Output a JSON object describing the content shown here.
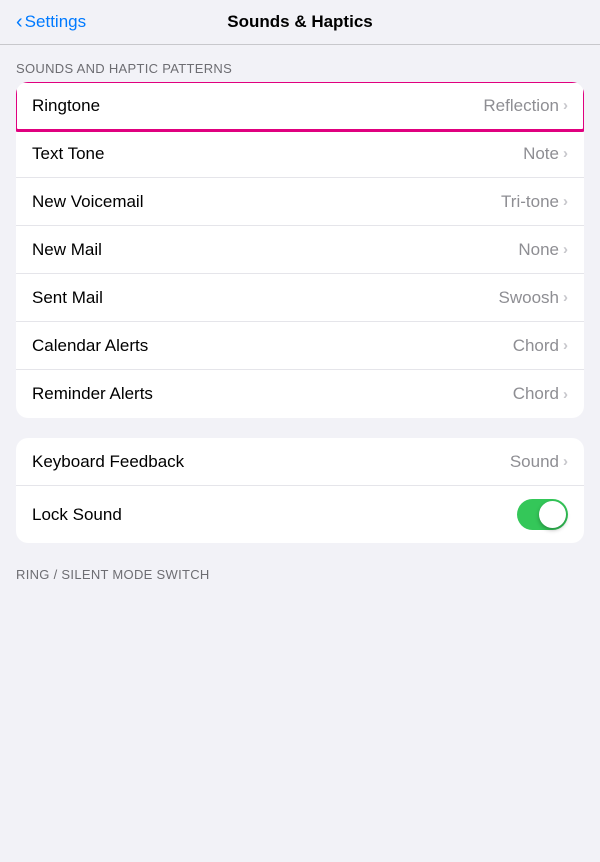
{
  "header": {
    "back_label": "Settings",
    "title": "Sounds & Haptics"
  },
  "sounds_section": {
    "label": "SOUNDS AND HAPTIC PATTERNS",
    "rows": [
      {
        "id": "ringtone",
        "label": "Ringtone",
        "value": "Reflection",
        "highlighted": true
      },
      {
        "id": "text-tone",
        "label": "Text Tone",
        "value": "Note",
        "highlighted": false
      },
      {
        "id": "new-voicemail",
        "label": "New Voicemail",
        "value": "Tri-tone",
        "highlighted": false
      },
      {
        "id": "new-mail",
        "label": "New Mail",
        "value": "None",
        "highlighted": false
      },
      {
        "id": "sent-mail",
        "label": "Sent Mail",
        "value": "Swoosh",
        "highlighted": false
      },
      {
        "id": "calendar-alerts",
        "label": "Calendar Alerts",
        "value": "Chord",
        "highlighted": false
      },
      {
        "id": "reminder-alerts",
        "label": "Reminder Alerts",
        "value": "Chord",
        "highlighted": false
      }
    ]
  },
  "feedback_section": {
    "rows": [
      {
        "id": "keyboard-feedback",
        "label": "Keyboard Feedback",
        "value": "Sound",
        "type": "navigation"
      },
      {
        "id": "lock-sound",
        "label": "Lock Sound",
        "type": "toggle",
        "enabled": true
      }
    ]
  },
  "bottom_section": {
    "label": "RING / SILENT MODE SWITCH"
  },
  "icons": {
    "chevron": "›"
  }
}
